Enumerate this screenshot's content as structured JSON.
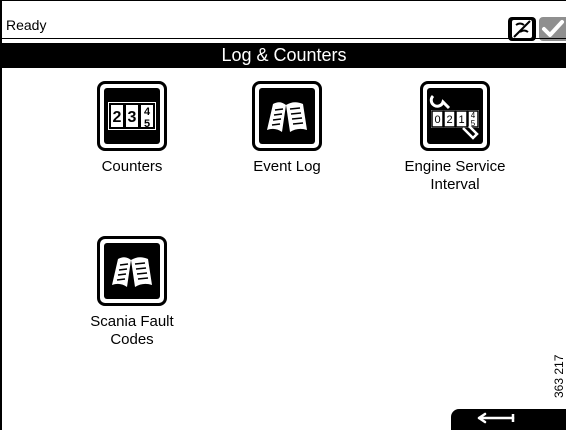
{
  "status": {
    "text": "Ready",
    "icons": [
      "no-signal-icon",
      "checkbox-icon"
    ]
  },
  "header": {
    "title": "Log & Counters"
  },
  "menu": {
    "items": [
      {
        "label": "Counters",
        "icon": "counters-icon"
      },
      {
        "label": "Event Log",
        "icon": "book-icon"
      },
      {
        "label": "Engine Service Interval",
        "icon": "wrench-counter-icon"
      },
      {
        "label": "Scania Fault Codes",
        "icon": "book-icon"
      }
    ]
  },
  "side_number": "363 217",
  "footer": {
    "back_icon": "back-arrow-icon"
  },
  "colors": {
    "bar": "#000000",
    "disabled": "#8f8f8f"
  }
}
